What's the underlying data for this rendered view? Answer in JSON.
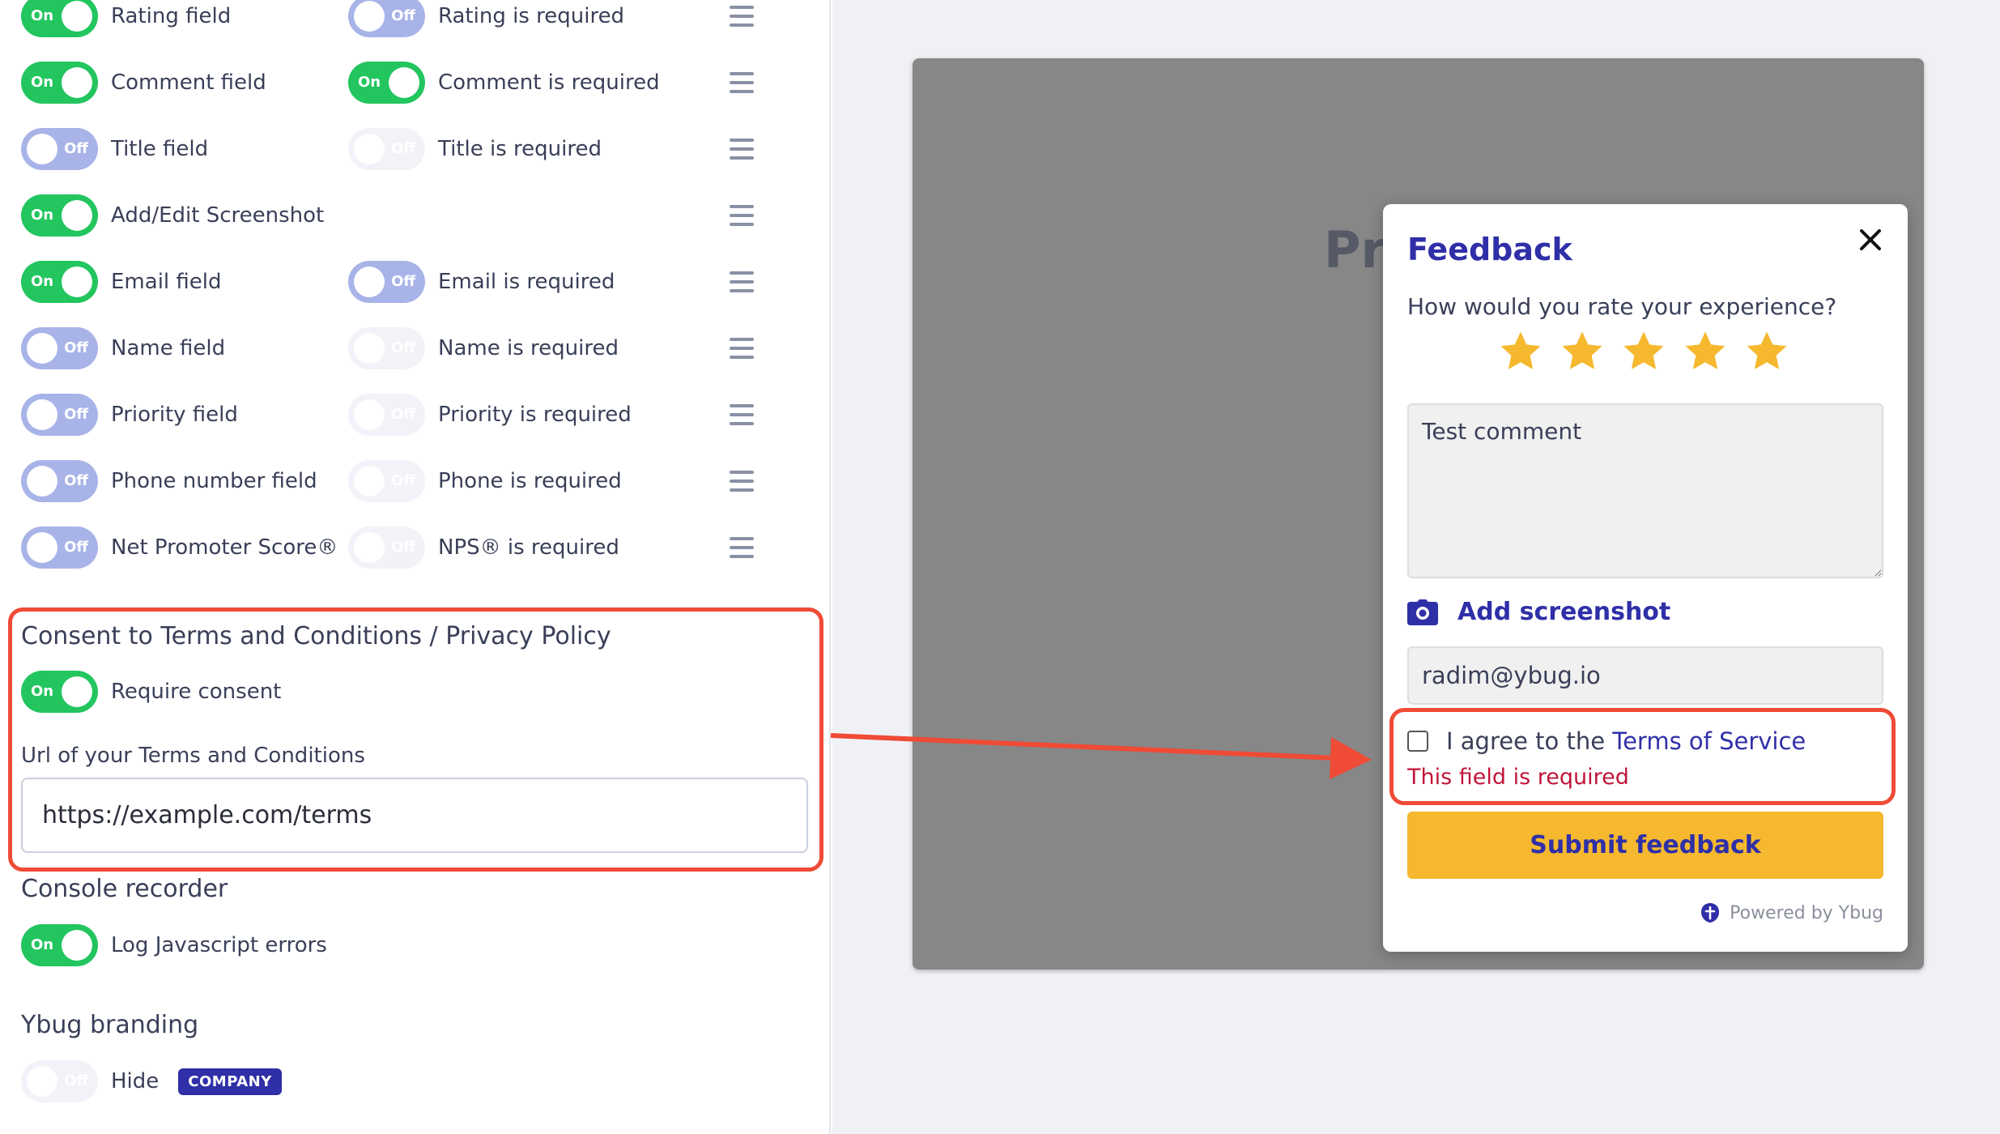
{
  "fields": [
    {
      "label": "Rating field",
      "state": "On",
      "req_label": "Rating is required",
      "req_state": "Off",
      "req_style": "off"
    },
    {
      "label": "Comment field",
      "state": "On",
      "req_label": "Comment is required",
      "req_state": "On",
      "req_style": "on"
    },
    {
      "label": "Title field",
      "state": "Off",
      "req_label": "Title is required",
      "req_state": "Off",
      "req_style": "dis"
    },
    {
      "label": "Add/Edit Screenshot",
      "state": "On",
      "req_label": "",
      "req_state": "",
      "req_style": "none"
    },
    {
      "label": "Email field",
      "state": "On",
      "req_label": "Email is required",
      "req_state": "Off",
      "req_style": "off"
    },
    {
      "label": "Name field",
      "state": "Off",
      "req_label": "Name is required",
      "req_state": "Off",
      "req_style": "dis"
    },
    {
      "label": "Priority field",
      "state": "Off",
      "req_label": "Priority is required",
      "req_state": "Off",
      "req_style": "dis"
    },
    {
      "label": "Phone number field",
      "state": "Off",
      "req_label": "Phone is required",
      "req_state": "Off",
      "req_style": "dis"
    },
    {
      "label": "Net Promoter Score®",
      "state": "Off",
      "req_label": "NPS® is required",
      "req_state": "Off",
      "req_style": "dis"
    }
  ],
  "consent": {
    "heading": "Consent to Terms and Conditions / Privacy Policy",
    "toggle_state": "On",
    "toggle_label": "Require consent",
    "url_label": "Url of your Terms and Conditions",
    "url_value": "https://example.com/terms"
  },
  "console": {
    "heading": "Console recorder",
    "toggle_state": "On",
    "toggle_label": "Log Javascript errors"
  },
  "branding": {
    "heading": "Ybug branding",
    "toggle_state": "Off",
    "toggle_label": "Hide",
    "badge": "COMPANY"
  },
  "stage": {
    "title": "Pr"
  },
  "widget": {
    "title": "Feedback",
    "question": "How would you rate your experience?",
    "rating": 5,
    "rating_max": 5,
    "comment": "Test comment",
    "screenshot_label": "Add screenshot",
    "email": "radim@ybug.io",
    "agree_prefix": "I agree to the",
    "agree_link": "Terms of Service",
    "error": "This field is required",
    "submit": "Submit feedback",
    "powered": "Powered by Ybug"
  },
  "colors": {
    "toggle_on": "#22c55e",
    "toggle_off": "#a8b3e8",
    "brand": "#2f2fa8",
    "star": "#f5b82e",
    "highlight": "#ef4b36",
    "error": "#c0153a"
  },
  "icons": {
    "drag": "drag-handle-icon",
    "close": "close-icon",
    "star": "star-icon",
    "camera": "camera-icon",
    "ybug": "ybug-logo-icon"
  }
}
